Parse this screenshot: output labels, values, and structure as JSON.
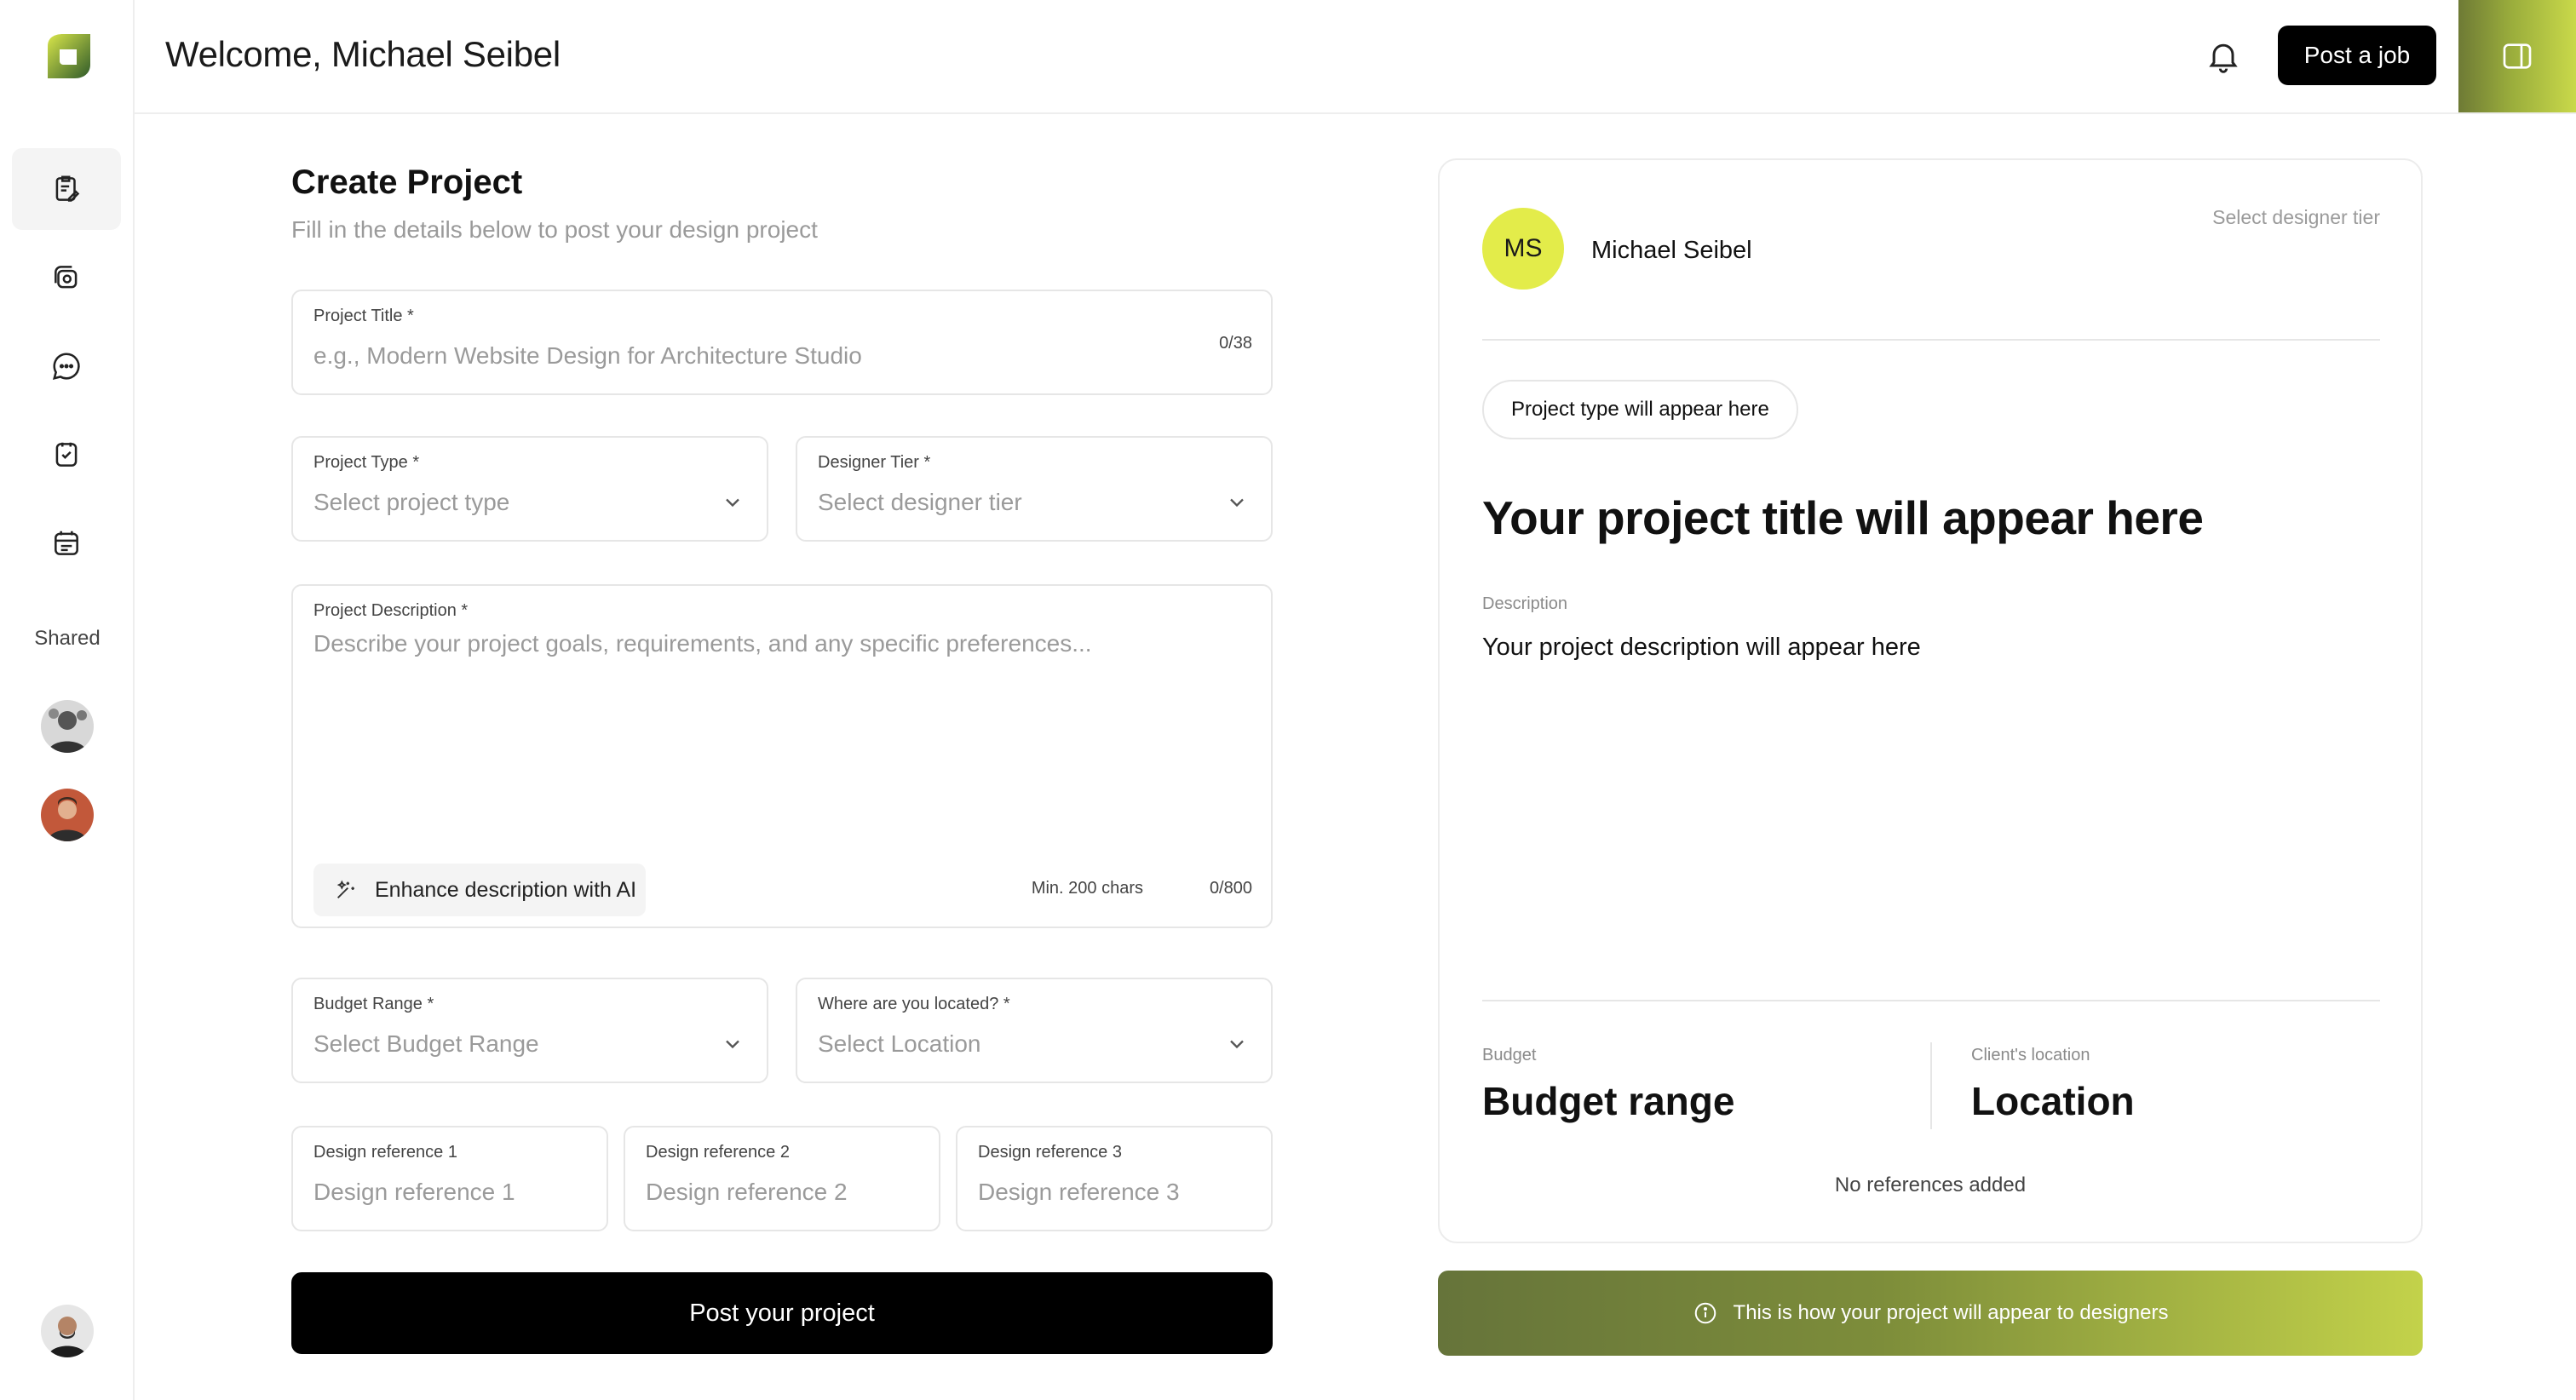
{
  "header": {
    "welcome": "Welcome, Michael Seibel",
    "post_job_label": "Post a job"
  },
  "sidebar": {
    "items": [
      {
        "icon": "clipboard-edit-icon",
        "active": true
      },
      {
        "icon": "camera-layers-icon",
        "active": false
      },
      {
        "icon": "chat-bubble-icon",
        "active": false
      },
      {
        "icon": "document-check-icon",
        "active": false
      },
      {
        "icon": "calendar-list-icon",
        "active": false
      }
    ],
    "shared_label": "Shared"
  },
  "form": {
    "title": "Create Project",
    "subtitle": "Fill in the details below to post your design project",
    "project_title": {
      "label": "Project Title *",
      "placeholder": "e.g., Modern Website Design for Architecture Studio",
      "counter": "0/38"
    },
    "project_type": {
      "label": "Project Type *",
      "placeholder": "Select project type"
    },
    "designer_tier": {
      "label": "Designer Tier *",
      "placeholder": "Select designer tier"
    },
    "description": {
      "label": "Project Description *",
      "placeholder": "Describe your project goals, requirements, and any specific preferences...",
      "enhance_label": "Enhance description with AI",
      "min_chars": "Min. 200 chars",
      "counter": "0/800"
    },
    "budget": {
      "label": "Budget Range *",
      "placeholder": "Select Budget Range"
    },
    "location": {
      "label": "Where are you located? *",
      "placeholder": "Select Location"
    },
    "references": [
      {
        "label": "Design reference 1",
        "placeholder": "Design reference 1"
      },
      {
        "label": "Design reference 2",
        "placeholder": "Design reference 2"
      },
      {
        "label": "Design reference 3",
        "placeholder": "Design reference 3"
      }
    ],
    "submit_label": "Post your project"
  },
  "preview": {
    "avatar_initials": "MS",
    "name": "Michael Seibel",
    "tier": "Select designer tier",
    "type_pill": "Project type will appear here",
    "title": "Your project title will appear here",
    "description_label": "Description",
    "description": "Your project description will appear here",
    "budget_label": "Budget",
    "budget": "Budget range",
    "location_label": "Client's location",
    "location": "Location",
    "references": "No references added",
    "banner": "This is how your project will appear to designers"
  },
  "colors": {
    "accent": "#e3ec4a",
    "banner_start": "#66743a",
    "banner_end": "#c3d24a",
    "primary_button": "#000000"
  }
}
